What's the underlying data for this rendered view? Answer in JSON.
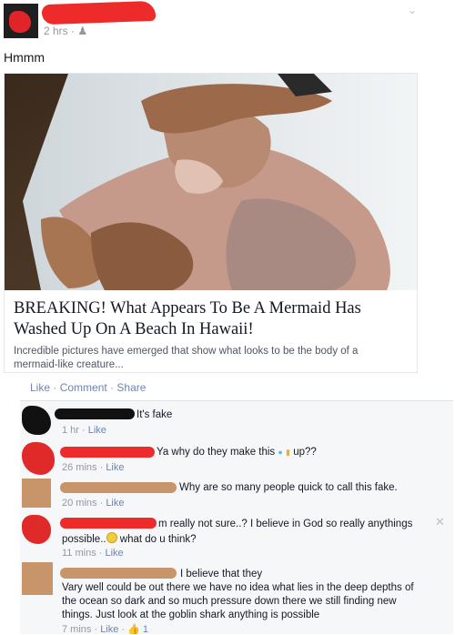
{
  "post": {
    "timestamp": "2 hrs",
    "audience_icon": "friends-icon",
    "status": "Hmmm"
  },
  "link_preview": {
    "headline": "BREAKING! What Appears To Be A Mermaid Has Washed Up On A Beach In Hawaii!",
    "summary": "Incredible pictures have emerged that show what looks to be the body of a mermaid-like creature..."
  },
  "actions": {
    "like": "Like",
    "comment": "Comment",
    "share": "Share",
    "separator": "·"
  },
  "comments": [
    {
      "text": "It's fake",
      "time": "1 hr",
      "like": "Like"
    },
    {
      "text_before": "Ya why do they make this",
      "text_after": "up??",
      "time": "26 mins",
      "like": "Like"
    },
    {
      "text": "Why are so many people quick to call this fake.",
      "time": "20 mins",
      "like": "Like"
    },
    {
      "text_line1": "m really not sure..? I believe in God so really anythings",
      "text_line2_before": "possible..",
      "text_line2_after": "what do u think?",
      "time": "11 mins",
      "like": "Like"
    },
    {
      "text_line1": "I believe that they",
      "text_line2": "Vary well could be out there we have no idea what lies in the deep depths of",
      "text_line3": "the ocean so dark and so much pressure down there we still finding new",
      "text_line4": "things. Just look at the goblin shark anything is possible",
      "time": "7 mins",
      "like": "Like",
      "like_count": "1"
    }
  ],
  "colors": {
    "link": "#6d84b4",
    "meta": "#9197a3",
    "scribble_red": "#ee2b2b",
    "scribble_tan": "#c8946a"
  }
}
